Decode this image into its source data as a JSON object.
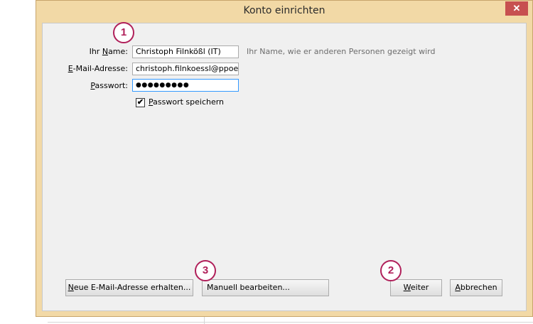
{
  "window": {
    "title": "Konto einrichten",
    "close_label": "✕"
  },
  "form": {
    "name": {
      "label_prefix": "Ihr ",
      "label_accel": "N",
      "label_rest": "ame:",
      "value": "Christoph Filnkößl (IT)",
      "hint": "Ihr Name, wie er anderen Personen gezeigt wird"
    },
    "email": {
      "label_accel": "E",
      "label_rest": "-Mail-Adresse:",
      "value": "christoph.filnkoessl@ppoe."
    },
    "password": {
      "label_accel": "P",
      "label_rest": "asswort:",
      "value": "●●●●●●●●●"
    },
    "save_password": {
      "checked": true,
      "check_glyph": "✔",
      "label_accel": "P",
      "label_rest": "asswort speichern"
    }
  },
  "buttons": {
    "new_email": {
      "accel": "N",
      "rest": "eue E-Mail-Adresse erhalten..."
    },
    "manual": "Manuell bearbeiten...",
    "next": {
      "accel": "W",
      "rest": "eiter"
    },
    "cancel": {
      "accel": "A",
      "rest": "bbrechen"
    }
  },
  "badges": [
    "1",
    "2",
    "3"
  ],
  "colors": {
    "window_frame": "#f2d9a6",
    "client_bg": "#f0f0f0",
    "badge": "#b0205a",
    "close": "#c75050"
  }
}
